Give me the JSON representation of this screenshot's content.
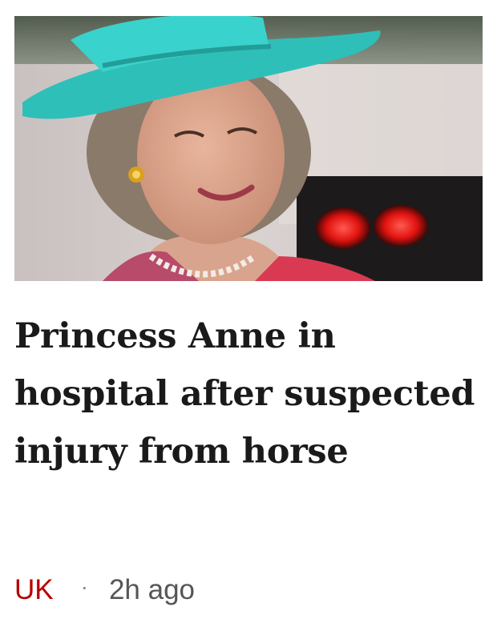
{
  "article": {
    "image_subject": "Princess Anne wearing a turquoise hat",
    "headline": "Princess Anne in hospital after suspected injury from horse",
    "section": "UK",
    "separator": "·",
    "timestamp": "2h ago"
  },
  "colors": {
    "section_link": "#b80000",
    "headline": "#1a1a1a",
    "timestamp": "#545658",
    "hat": "#35c9c3"
  }
}
